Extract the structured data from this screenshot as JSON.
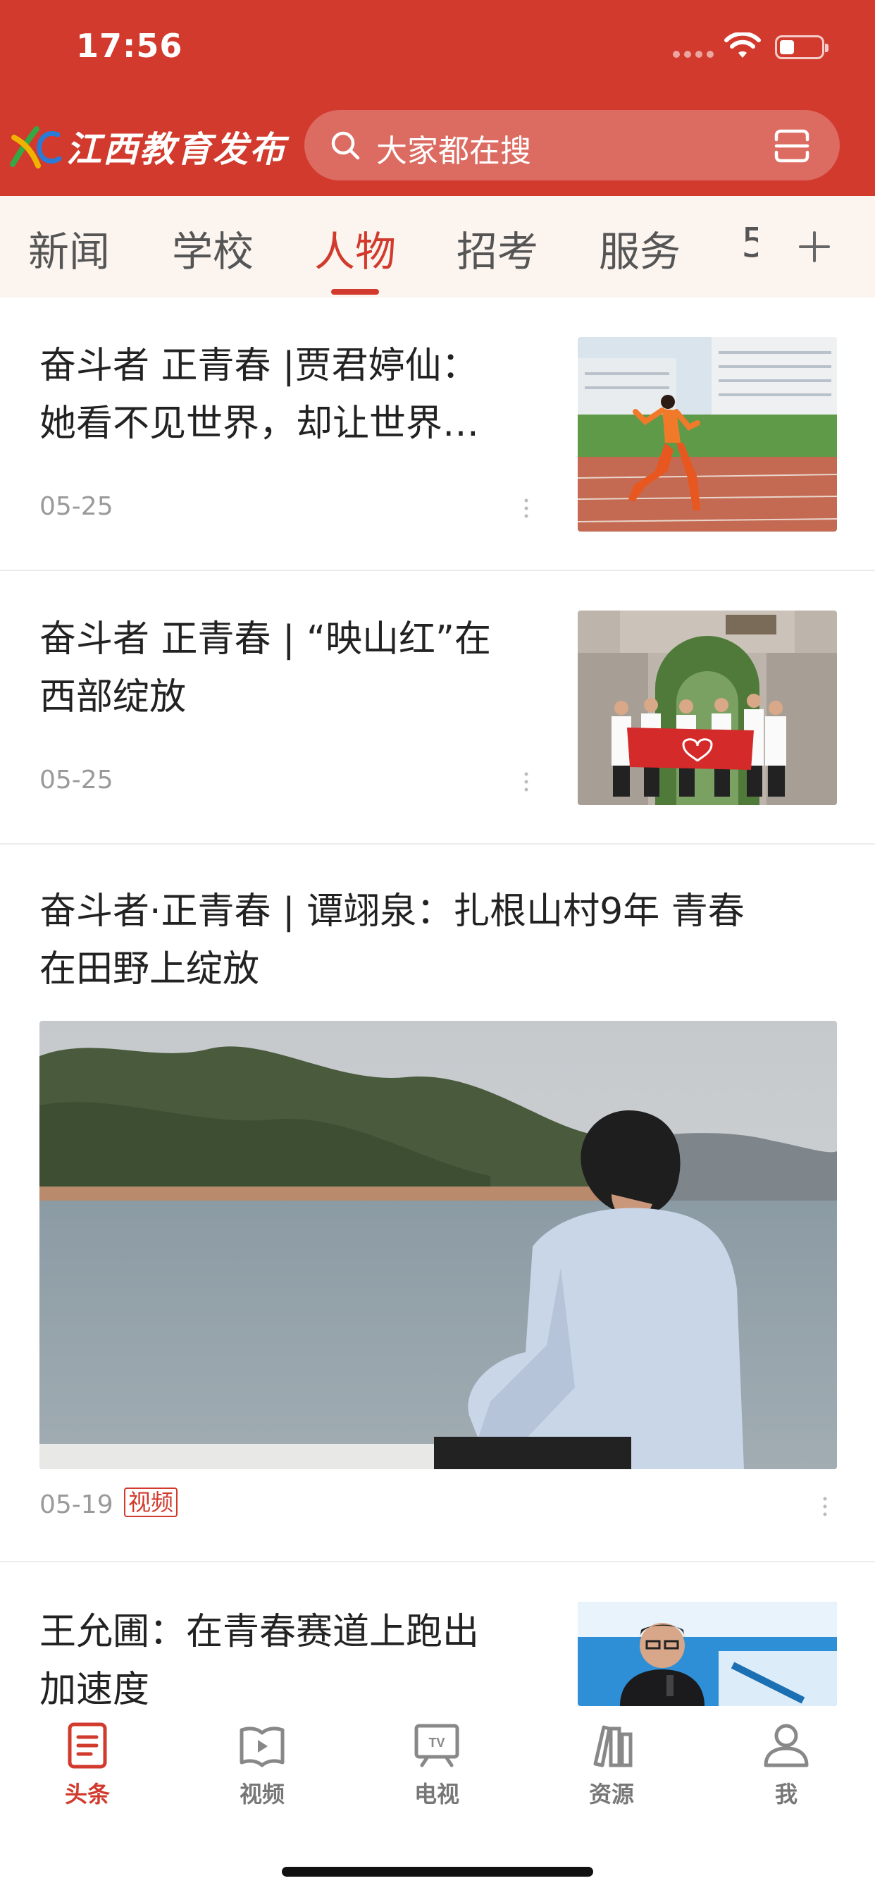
{
  "status_bar": {
    "time": "17:56"
  },
  "header": {
    "logo_text": "江西教育发布",
    "search_placeholder": "大家都在搜",
    "brand_color": "#d13a2c"
  },
  "tabs": {
    "items": [
      "新闻",
      "学校",
      "人物",
      "招考",
      "服务"
    ],
    "active_index": 2,
    "clipped_next": "5"
  },
  "articles": [
    {
      "title_line1": "奋斗者 正青春 |贾君婷仙：",
      "title_line2": "她看不见世界，却让世界…",
      "date": "05-25",
      "image": "athlete-running-track"
    },
    {
      "title_line1": "奋斗者 正青春 | “映山红”在",
      "title_line2": "西部绽放",
      "date": "05-25",
      "image": "group-with-red-banner"
    },
    {
      "title_line1": "奋斗者·正青春 | 谭翊泉：扎根山村9年  青春",
      "title_line2": "在田野上绽放",
      "date": "05-19",
      "tag": "视频",
      "image": "man-sitting-by-lake"
    },
    {
      "title_line1": "王允圃：在青春赛道上跑出",
      "title_line2": "加速度",
      "image": "man-speaking-microphone"
    }
  ],
  "bottom_nav": {
    "items": [
      {
        "label": "头条",
        "icon": "document-icon"
      },
      {
        "label": "视频",
        "icon": "video-book-icon"
      },
      {
        "label": "电视",
        "icon": "tv-icon"
      },
      {
        "label": "资源",
        "icon": "books-icon"
      },
      {
        "label": "我",
        "icon": "person-icon"
      }
    ],
    "active_index": 0
  }
}
